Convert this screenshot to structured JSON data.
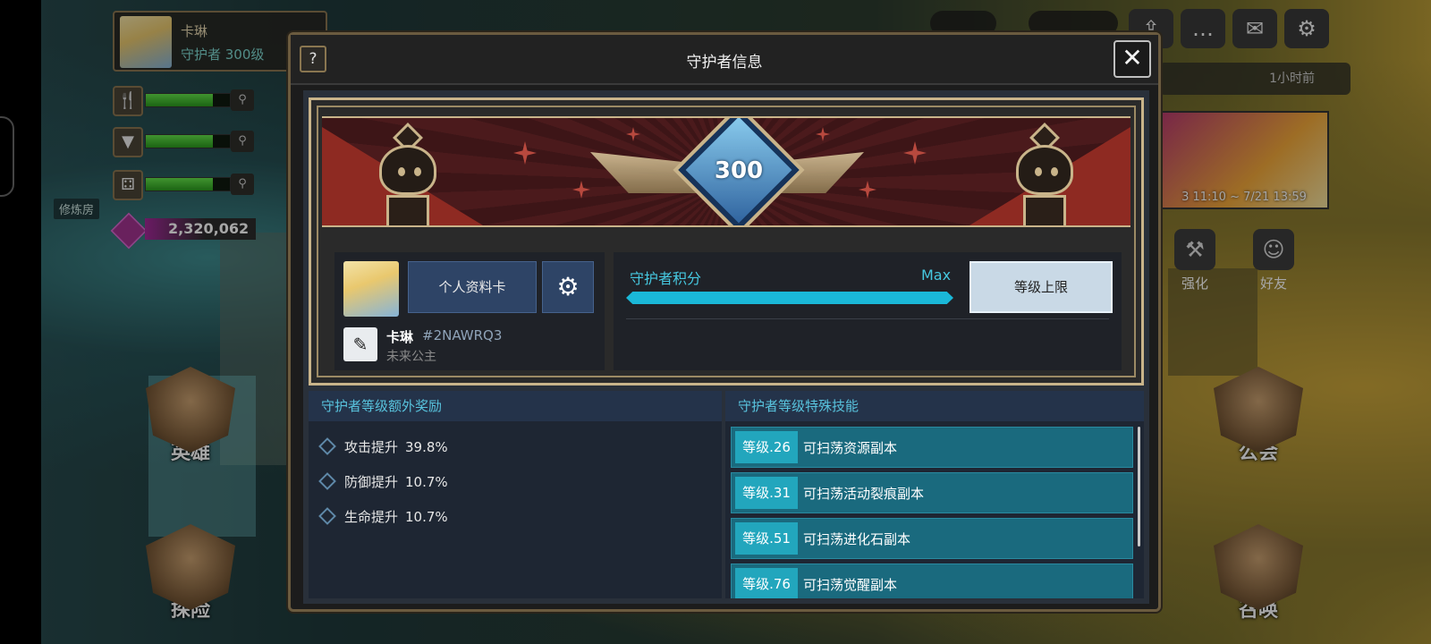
{
  "hud": {
    "player_name": "卡琳",
    "player_rank": "守护者 300级",
    "training_room": "修炼房",
    "gems": "2,320,062",
    "notice_time": "1小时前",
    "event_dates": "3 11:10 ~ 7/21 13:59",
    "side_buttons": {
      "enhance": "强化",
      "friends": "好友"
    },
    "nav": {
      "hero": "英雄",
      "adventure": "探险",
      "guild": "公会",
      "summon": "召唤"
    }
  },
  "modal": {
    "title": "守护者信息",
    "help_label": "?",
    "close_label": "✕",
    "level": "300",
    "profile": {
      "profile_card_label": "个人资料卡",
      "name": "卡琳",
      "id": "#2NAWRQ3",
      "title": "未来公主"
    },
    "points": {
      "label": "守护者积分",
      "max_label": "Max",
      "progress": 1.0,
      "cap_button": "等级上限"
    },
    "bonus": {
      "header": "守护者等级额外奖励",
      "items": [
        {
          "label": "攻击提升",
          "value": "39.8%"
        },
        {
          "label": "防御提升",
          "value": "10.7%"
        },
        {
          "label": "生命提升",
          "value": "10.7%"
        }
      ]
    },
    "skills": {
      "header": "守护者等级特殊技能",
      "items": [
        {
          "level": "等级.26",
          "text": "可扫荡资源副本"
        },
        {
          "level": "等级.31",
          "text": "可扫荡活动裂痕副本"
        },
        {
          "level": "等级.51",
          "text": "可扫荡进化石副本"
        },
        {
          "level": "等级.76",
          "text": "可扫荡觉醒副本"
        }
      ]
    }
  },
  "colors": {
    "accent": "#46c8e0",
    "frame_gold": "#c9b48a",
    "button_blue": "#2e4466",
    "skill_row": "#1a6a7e"
  }
}
